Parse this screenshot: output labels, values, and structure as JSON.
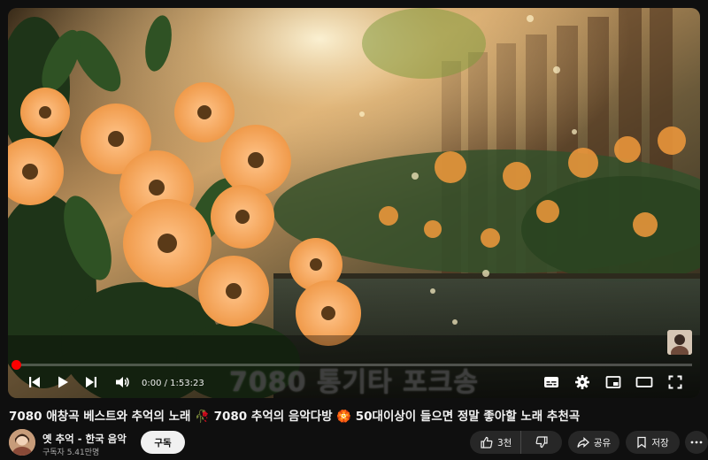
{
  "player": {
    "overlay_title": "7080 통기타 포크송",
    "time_display": "0:00 / 1:53:23",
    "progress": 0.0
  },
  "video": {
    "title": "7080 애창곡 베스트와 추억의 노래 🥀 7080 추억의 음악다방 🏵️ 50대이상이 들으면 정말 좋아할 노래 추천곡"
  },
  "channel": {
    "name": "옛 추억 - 한국 음악",
    "subscribers": "구독자 5.41만명",
    "subscribe_label": "구독"
  },
  "actions": {
    "like_count": "3천",
    "share_label": "공유",
    "save_label": "저장"
  },
  "icons": {
    "prev": "skip-previous-icon",
    "play": "play-icon",
    "next": "skip-next-icon",
    "volume": "volume-icon",
    "subtitles": "subtitles-icon",
    "settings": "gear-icon",
    "miniplayer": "miniplayer-icon",
    "theater": "theater-mode-icon",
    "fullscreen": "fullscreen-icon"
  },
  "colors": {
    "background": "#0f0f0f",
    "progress": "#ff0000",
    "pill": "#272727",
    "subscribe_bg": "#f1f1f1"
  }
}
